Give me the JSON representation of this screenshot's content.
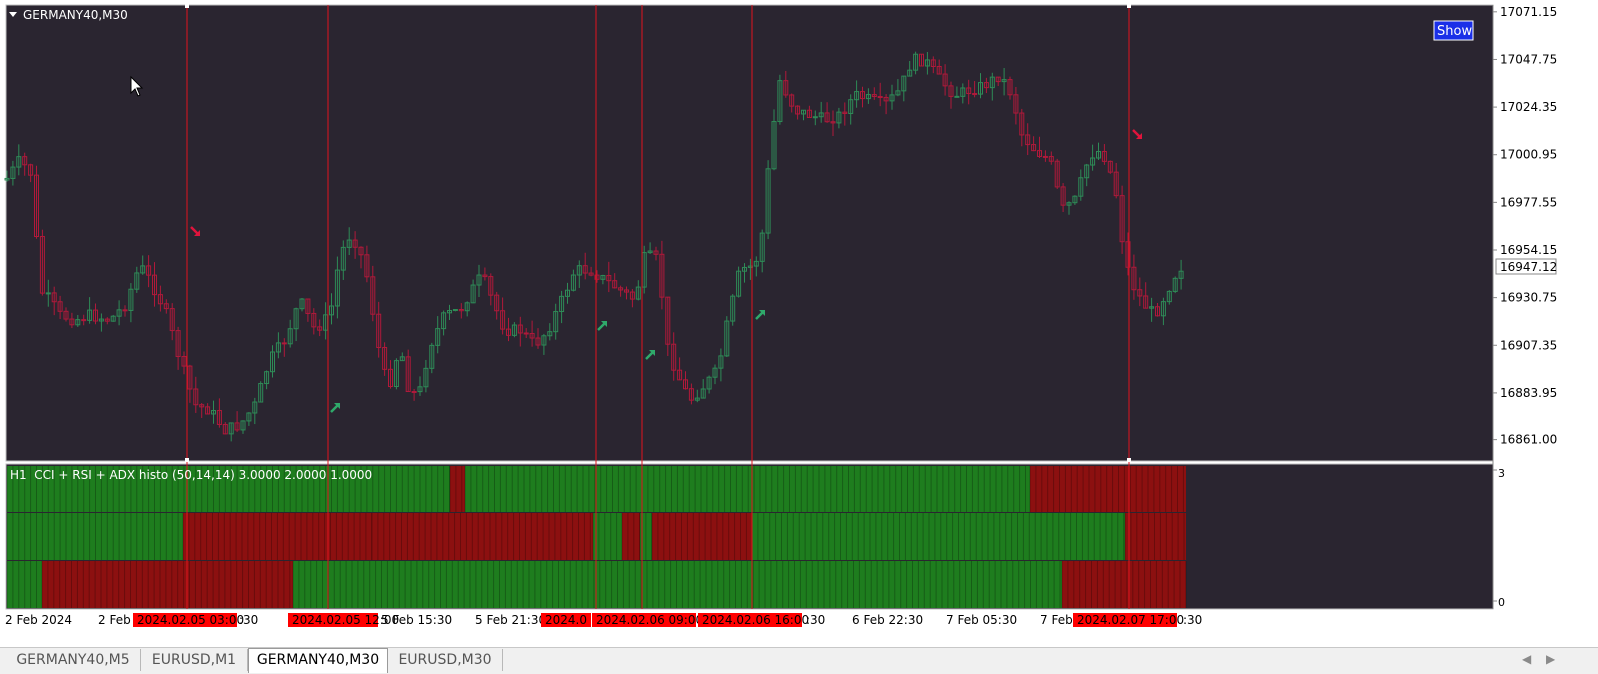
{
  "chart": {
    "symbol_label": "GERMANY40,M30",
    "show_button": "Show",
    "current_price": "16947.12",
    "price_ticks": [
      "17071.15",
      "17047.75",
      "17024.35",
      "17000.95",
      "16977.55",
      "16954.15",
      "16930.75",
      "16907.35",
      "16883.95",
      "16861.00"
    ],
    "price_range": [
      16850.5,
      17074.5
    ],
    "time_labels": [
      {
        "text": "2 Feb 2024",
        "highlight": false
      },
      {
        "text": "2 Feb",
        "highlight": false
      },
      {
        "text": "2024.02.05 03:00",
        "highlight": true
      },
      {
        "text": ":30",
        "highlight": false
      },
      {
        "text": "2024.02.05 12:00",
        "highlight": true
      },
      {
        "text": "5 Feb 15:30",
        "highlight": false
      },
      {
        "text": "5 Feb 21:30",
        "highlight": false
      },
      {
        "text": "2024.0",
        "highlight": true
      },
      {
        "text": "2024.02.06 09:00",
        "highlight": true
      },
      {
        "text": "2024.02.06 16:00",
        "highlight": true
      },
      {
        "text": ":30",
        "highlight": false
      },
      {
        "text": "6 Feb 22:30",
        "highlight": false
      },
      {
        "text": "7 Feb 05:30",
        "highlight": false
      },
      {
        "text": "7 Feb",
        "highlight": false
      },
      {
        "text": "2024.02.07 17:00",
        "highlight": true
      },
      {
        "text": ":30",
        "highlight": false
      }
    ],
    "colors": {
      "bg": "#2a2530",
      "bull": "#2e8b57",
      "bear": "#b0193a",
      "vline": "#e0141e",
      "arrow_up": "#2fa96a",
      "arrow_down": "#e0143c",
      "histo_green": "#1e7d1e",
      "histo_red": "#8c1010",
      "highlight": "#ff0000"
    }
  },
  "indicator": {
    "label": "H1  CCI + RSI + ADX histo (50,14,14) 3.0000 2.0000 1.0000",
    "scale_top": "3",
    "scale_bottom": "0"
  },
  "tabs": [
    {
      "label": "GERMANY40,M5",
      "active": false
    },
    {
      "label": "EURUSD,M1",
      "active": false
    },
    {
      "label": "GERMANY40,M30",
      "active": true
    },
    {
      "label": "EURUSD,M30",
      "active": false
    }
  ],
  "icons": {
    "collapse": "triangle-down-icon",
    "cursor": "mouse-pointer-icon",
    "scroll_left": "arrow-left-icon",
    "scroll_right": "arrow-right-icon"
  }
}
